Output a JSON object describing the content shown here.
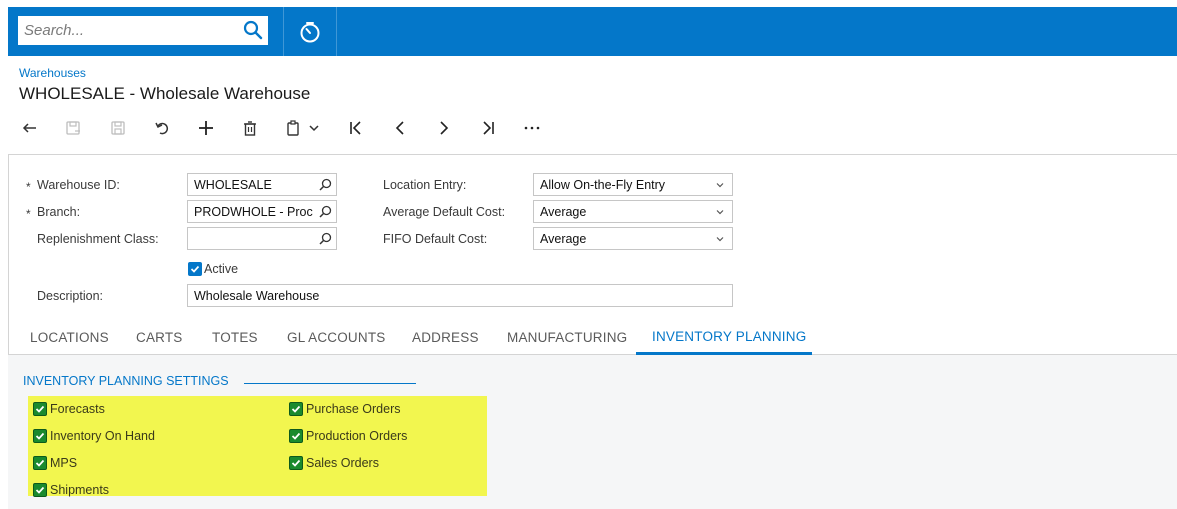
{
  "search": {
    "placeholder": "Search..."
  },
  "breadcrumb": "Warehouses",
  "page_title": "WHOLESALE - Wholesale Warehouse",
  "toolbar": {
    "icons": [
      "back-icon",
      "save-close-icon",
      "save-icon",
      "cancel-icon",
      "add-icon",
      "delete-icon",
      "copy-paste-icon",
      "first-record-icon",
      "previous-record-icon",
      "next-record-icon",
      "last-record-icon",
      "more-icon"
    ]
  },
  "form": {
    "warehouse_id": {
      "required": "*",
      "label": "Warehouse ID:",
      "value": "WHOLESALE"
    },
    "branch": {
      "required": "*",
      "label": "Branch:",
      "value": "PRODWHOLE - Proc"
    },
    "replenishment_class": {
      "label": "Replenishment Class:",
      "value": ""
    },
    "active": {
      "label": "Active",
      "checked": true
    },
    "description": {
      "label": "Description:",
      "value": "Wholesale Warehouse"
    },
    "location_entry": {
      "label": "Location Entry:",
      "value": "Allow On-the-Fly Entry"
    },
    "avg_default_cost": {
      "label": "Average Default Cost:",
      "value": "Average"
    },
    "fifo_default_cost": {
      "label": "FIFO Default Cost:",
      "value": "Average"
    }
  },
  "tabs": [
    {
      "label": "LOCATIONS",
      "active": false
    },
    {
      "label": "CARTS",
      "active": false
    },
    {
      "label": "TOTES",
      "active": false
    },
    {
      "label": "GL ACCOUNTS",
      "active": false
    },
    {
      "label": "ADDRESS",
      "active": false
    },
    {
      "label": "MANUFACTURING",
      "active": false
    },
    {
      "label": "INVENTORY PLANNING",
      "active": true
    }
  ],
  "inventory_planning": {
    "section_title": "INVENTORY PLANNING SETTINGS",
    "checkboxes": [
      {
        "label": "Forecasts",
        "checked": true
      },
      {
        "label": "Inventory On Hand",
        "checked": true
      },
      {
        "label": "MPS",
        "checked": true
      },
      {
        "label": "Shipments",
        "checked": true
      },
      {
        "label": "Purchase Orders",
        "checked": true
      },
      {
        "label": "Production Orders",
        "checked": true
      },
      {
        "label": "Sales Orders",
        "checked": true
      }
    ]
  },
  "colors": {
    "accent": "#0477c9",
    "highlight": "#f2f64f",
    "check_green": "#1a8a2e"
  }
}
